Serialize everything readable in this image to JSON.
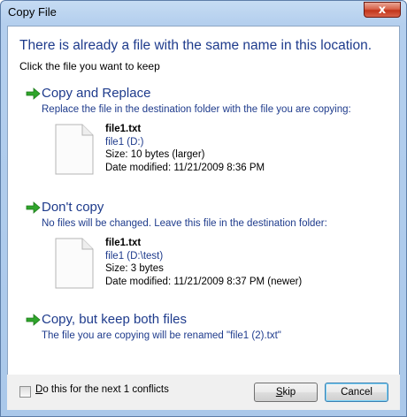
{
  "window": {
    "title": "Copy File",
    "close_glyph": "x"
  },
  "header": {
    "title": "There is already a file with the same name in this location.",
    "subtitle": "Click the file you want to keep"
  },
  "options": [
    {
      "title": "Copy and Replace",
      "description": "Replace the file in the destination folder with the file you are copying:",
      "file": {
        "name": "file1.txt",
        "location": "file1 (D:)",
        "size": "Size: 10 bytes (larger)",
        "modified": "Date modified: 11/21/2009 8:36 PM"
      }
    },
    {
      "title": "Don't copy",
      "description": "No files will be changed. Leave this file in the destination folder:",
      "file": {
        "name": "file1.txt",
        "location": "file1 (D:\\test)",
        "size": "Size: 3 bytes",
        "modified": "Date modified: 11/21/2009 8:37 PM (newer)"
      }
    },
    {
      "title": "Copy, but keep both files",
      "description": "The file you are copying will be renamed \"file1 (2).txt\""
    }
  ],
  "footer": {
    "checkbox_underlined": "D",
    "checkbox_label_rest": "o this for the next 1 conflicts",
    "checkbox_checked": false,
    "skip_underlined": "S",
    "skip_rest": "kip",
    "cancel_label": "Cancel"
  },
  "colors": {
    "link_blue": "#1e3b8c",
    "arrow_green": "#2fa52b",
    "title_bar": "#b4cfee"
  },
  "icons": {
    "arrow": "green-right-arrow-icon",
    "file": "text-file-icon",
    "close": "close-icon"
  }
}
